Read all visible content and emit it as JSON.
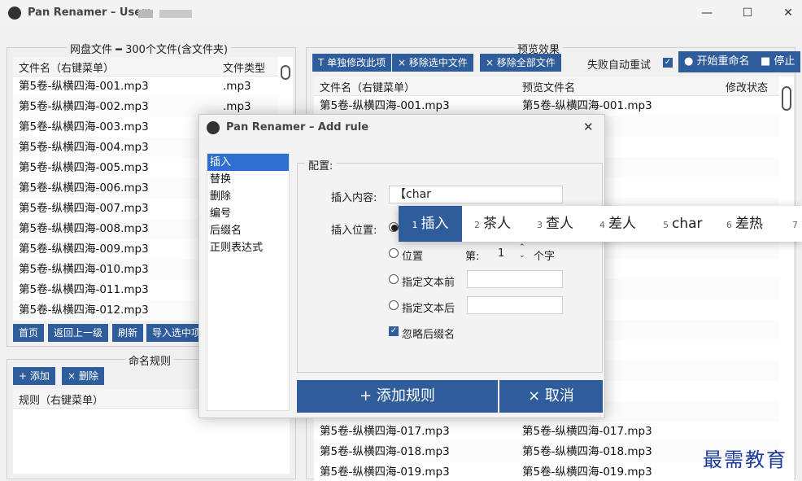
{
  "window": {
    "title": "Pan Renamer – User:",
    "controls": {
      "minimize": "—",
      "maximize": "☐",
      "close": "✕"
    }
  },
  "left_panel": {
    "group_title": "网盘文件 ━ 300个文件(含文件夹)",
    "columns": [
      "文件名（右键菜单）",
      "文件类型"
    ],
    "rows": [
      {
        "name": "第5卷-纵横四海-001.mp3",
        "type": ".mp3"
      },
      {
        "name": "第5卷-纵横四海-002.mp3",
        "type": ".mp3"
      },
      {
        "name": "第5卷-纵横四海-003.mp3",
        "type": ""
      },
      {
        "name": "第5卷-纵横四海-004.mp3",
        "type": ""
      },
      {
        "name": "第5卷-纵横四海-005.mp3",
        "type": ""
      },
      {
        "name": "第5卷-纵横四海-006.mp3",
        "type": ""
      },
      {
        "name": "第5卷-纵横四海-007.mp3",
        "type": ""
      },
      {
        "name": "第5卷-纵横四海-008.mp3",
        "type": ""
      },
      {
        "name": "第5卷-纵横四海-009.mp3",
        "type": ""
      },
      {
        "name": "第5卷-纵横四海-010.mp3",
        "type": ""
      },
      {
        "name": "第5卷-纵横四海-011.mp3",
        "type": ""
      },
      {
        "name": "第5卷-纵横四海-012.mp3",
        "type": ""
      }
    ],
    "buttons": [
      "首页",
      "返回上一级",
      "刷新",
      "导入选中项"
    ]
  },
  "rules_panel": {
    "group_title": "命名规则",
    "add_button": "+ 添加",
    "delete_button": "× 删除",
    "column": "规则（右键菜单）"
  },
  "preview_panel": {
    "group_title": "预览效果",
    "buttons": {
      "edit_single": "T 单独修改此项",
      "remove_selected": "× 移除选中文件",
      "remove_all": "× 移除全部文件",
      "start": "● 开始重命名",
      "stop": "■ 停止"
    },
    "auto_retry_label": "失败自动重试",
    "columns": [
      "文件名（右键菜单）",
      "预览文件名",
      "修改状态"
    ],
    "rows": [
      {
        "name": "第5卷-纵横四海-001.mp3",
        "preview": "第5卷-纵横四海-001.mp3"
      },
      {
        "name": "",
        "preview": "002.mp3"
      },
      {
        "name": "",
        "preview": "003.mp3"
      },
      {
        "name": "",
        "preview": "004.mp3"
      },
      {
        "name": "",
        "preview": "005.mp3"
      },
      {
        "name": "",
        "preview": ""
      },
      {
        "name": "",
        "preview": ""
      },
      {
        "name": "",
        "preview": "008.mp3"
      },
      {
        "name": "",
        "preview": "009.mp3"
      },
      {
        "name": "",
        "preview": "010.mp3"
      },
      {
        "name": "",
        "preview": "011.mp3"
      },
      {
        "name": "",
        "preview": "012.mp3"
      },
      {
        "name": "",
        "preview": "013.mp3"
      },
      {
        "name": "",
        "preview": "014.mp3"
      },
      {
        "name": "",
        "preview": "015.mp3"
      },
      {
        "name": "",
        "preview": "016.mp3"
      },
      {
        "name": "第5卷-纵横四海-017.mp3",
        "preview": "第5卷-纵横四海-017.mp3"
      },
      {
        "name": "第5卷-纵横四海-018.mp3",
        "preview": "第5卷-纵横四海-018.mp3"
      },
      {
        "name": "第5卷-纵横四海-019.mp3",
        "preview": "第5卷-纵横四海-019.mp3"
      }
    ]
  },
  "dialog": {
    "title": "Pan Renamer – Add rule",
    "close": "✕",
    "rule_types": [
      "插入",
      "替换",
      "删除",
      "编号",
      "后缀名",
      "正则表达式"
    ],
    "config_title": "配置:",
    "insert_content_label": "插入内容:",
    "insert_content_value": "【char",
    "insert_position_label": "插入位置:",
    "position_label": "位置",
    "index_prefix": "第:",
    "index_value": "1",
    "index_suffix": "个字",
    "before_text_label": "指定文本前",
    "after_text_label": "指定文本后",
    "ignore_ext_label": "忽略后缀名",
    "add_rule_button": "+  添加规则",
    "cancel_button": "×  取消"
  },
  "ime": {
    "candidates": [
      {
        "n": "1",
        "text": "插入"
      },
      {
        "n": "2",
        "text": "茶人"
      },
      {
        "n": "3",
        "text": "查人"
      },
      {
        "n": "4",
        "text": "差人"
      },
      {
        "n": "5",
        "text": "char"
      },
      {
        "n": "6",
        "text": "差热"
      },
      {
        "n": "7",
        "text": "查"
      }
    ]
  },
  "watermark": "最需教育"
}
